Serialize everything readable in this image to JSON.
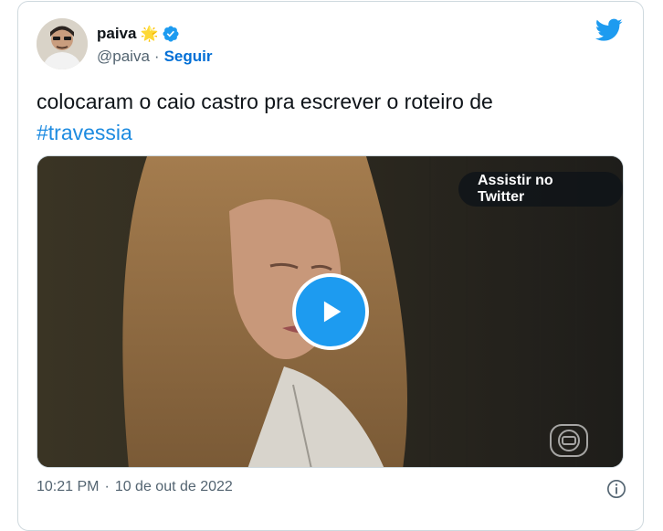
{
  "author": {
    "name": "paiva",
    "handle": "@paiva",
    "separator": "·",
    "follow_label": "Seguir",
    "badge_emoji": "🌟"
  },
  "tweet": {
    "text_plain": "colocaram o caio castro pra escrever o roteiro de",
    "hashtag": "#travessia"
  },
  "media": {
    "watch_label": "Assistir no Twitter",
    "play_icon": "play-icon",
    "watermark": "globo-watermark-icon"
  },
  "footer": {
    "time": "10:21 PM",
    "separator": "·",
    "date": "10 de out de 2022"
  },
  "colors": {
    "accent": "#1d9bf0",
    "link": "#006fd6",
    "verified": "#1d9bf0"
  }
}
